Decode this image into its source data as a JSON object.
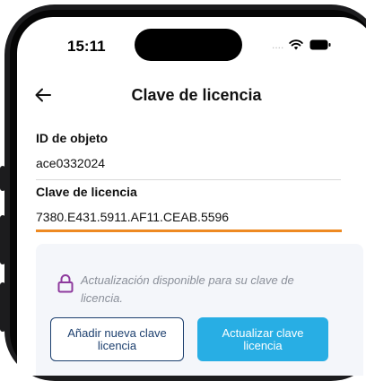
{
  "status_bar": {
    "time": "15:11",
    "signal": "....",
    "icons": [
      "wifi-icon",
      "battery-icon"
    ]
  },
  "header": {
    "back_icon": "arrow-left-icon",
    "title": "Clave de licencia"
  },
  "fields": {
    "object_id": {
      "label": "ID de objeto",
      "value": "ace0332024"
    },
    "license_key": {
      "label": "Clave de licencia",
      "value": "7380.E431.5911.AF11.CEAB.5596"
    }
  },
  "update_card": {
    "icon": "lock-icon",
    "message": "Actualización disponible para su clave de licencia.",
    "add_button_label": "Añadir nueva clave licencia",
    "update_button_label": "Actualizar clave licencia"
  },
  "colors": {
    "accent_orange": "#ee8a22",
    "primary_button": "#28aee4",
    "outline_button": "#1c3f6e",
    "lock_icon": "#8e3a9d",
    "card_background": "#f4f6fa"
  }
}
